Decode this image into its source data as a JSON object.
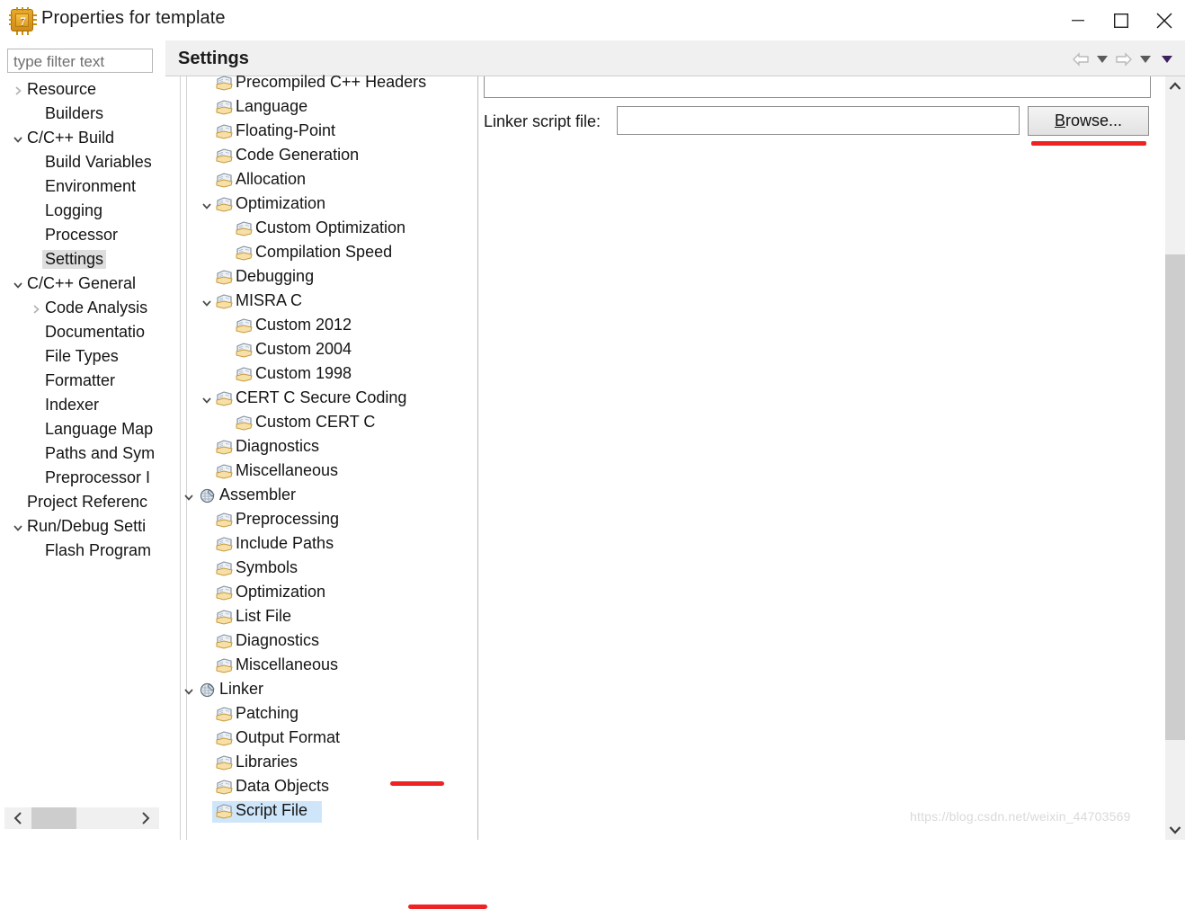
{
  "window": {
    "title": "Properties for template",
    "app_icon": "chip-icon",
    "icon_label": "7",
    "controls": {
      "minimize": "minimize-icon",
      "maximize": "maximize-icon",
      "close": "close-icon"
    }
  },
  "filter": {
    "placeholder": "type filter text",
    "value": ""
  },
  "left_tree": {
    "selected": "Settings",
    "items": [
      {
        "label": "Resource",
        "indent": 0,
        "arrow": "right"
      },
      {
        "label": "Builders",
        "indent": 1,
        "arrow": "none"
      },
      {
        "label": "C/C++ Build",
        "indent": 0,
        "arrow": "down"
      },
      {
        "label": "Build Variables",
        "indent": 1,
        "arrow": "none"
      },
      {
        "label": "Environment",
        "indent": 1,
        "arrow": "none"
      },
      {
        "label": "Logging",
        "indent": 1,
        "arrow": "none"
      },
      {
        "label": "Processor",
        "indent": 1,
        "arrow": "none"
      },
      {
        "label": "Settings",
        "indent": 1,
        "arrow": "none",
        "selected": true
      },
      {
        "label": "C/C++ General",
        "indent": 0,
        "arrow": "down"
      },
      {
        "label": "Code Analysis",
        "indent": 1,
        "arrow": "right"
      },
      {
        "label": "Documentatio",
        "indent": 1,
        "arrow": "none"
      },
      {
        "label": "File Types",
        "indent": 1,
        "arrow": "none"
      },
      {
        "label": "Formatter",
        "indent": 1,
        "arrow": "none"
      },
      {
        "label": "Indexer",
        "indent": 1,
        "arrow": "none"
      },
      {
        "label": "Language Map",
        "indent": 1,
        "arrow": "none"
      },
      {
        "label": "Paths and Sym",
        "indent": 1,
        "arrow": "none"
      },
      {
        "label": "Preprocessor I",
        "indent": 1,
        "arrow": "none"
      },
      {
        "label": "Project Referenc",
        "indent": 0,
        "arrow": "none"
      },
      {
        "label": "Run/Debug Setti",
        "indent": 0,
        "arrow": "down"
      },
      {
        "label": "Flash Program",
        "indent": 1,
        "arrow": "none"
      }
    ],
    "hscroll": {
      "left_arrow": "chevron-left-icon",
      "right_arrow": "chevron-right-icon"
    }
  },
  "page_header": {
    "title": "Settings",
    "nav": [
      {
        "name": "back-icon",
        "glyph": "arrow-left"
      },
      {
        "name": "back-dropdown-icon",
        "glyph": "caret-down"
      },
      {
        "name": "forward-icon",
        "glyph": "arrow-right"
      },
      {
        "name": "forward-dropdown-icon",
        "glyph": "caret-down"
      },
      {
        "name": "menu-dropdown-icon",
        "glyph": "caret-down-dark"
      }
    ]
  },
  "settings_tree": {
    "selected": "Script File",
    "items": [
      {
        "label": "Precompiled C++ Headers",
        "indent": 1,
        "arrow": "none",
        "icon": "page-icon",
        "clipped": true
      },
      {
        "label": "Language",
        "indent": 1,
        "arrow": "none",
        "icon": "page-icon"
      },
      {
        "label": "Floating-Point",
        "indent": 1,
        "arrow": "none",
        "icon": "page-icon"
      },
      {
        "label": "Code Generation",
        "indent": 1,
        "arrow": "none",
        "icon": "page-icon"
      },
      {
        "label": "Allocation",
        "indent": 1,
        "arrow": "none",
        "icon": "page-icon"
      },
      {
        "label": "Optimization",
        "indent": 1,
        "arrow": "down",
        "icon": "page-icon"
      },
      {
        "label": "Custom Optimization",
        "indent": 2,
        "arrow": "none",
        "icon": "page-icon"
      },
      {
        "label": "Compilation Speed",
        "indent": 2,
        "arrow": "none",
        "icon": "page-icon"
      },
      {
        "label": "Debugging",
        "indent": 1,
        "arrow": "none",
        "icon": "page-icon"
      },
      {
        "label": "MISRA C",
        "indent": 1,
        "arrow": "down",
        "icon": "page-icon"
      },
      {
        "label": "Custom 2012",
        "indent": 2,
        "arrow": "none",
        "icon": "page-icon"
      },
      {
        "label": "Custom 2004",
        "indent": 2,
        "arrow": "none",
        "icon": "page-icon"
      },
      {
        "label": "Custom 1998",
        "indent": 2,
        "arrow": "none",
        "icon": "page-icon"
      },
      {
        "label": "CERT C Secure Coding",
        "indent": 1,
        "arrow": "down",
        "icon": "page-icon"
      },
      {
        "label": "Custom CERT C",
        "indent": 2,
        "arrow": "none",
        "icon": "page-icon"
      },
      {
        "label": "Diagnostics",
        "indent": 1,
        "arrow": "none",
        "icon": "page-icon"
      },
      {
        "label": "Miscellaneous",
        "indent": 1,
        "arrow": "none",
        "icon": "page-icon"
      },
      {
        "label": "Assembler",
        "indent": 0,
        "arrow": "down",
        "icon": "tool-icon"
      },
      {
        "label": "Preprocessing",
        "indent": 1,
        "arrow": "none",
        "icon": "page-icon"
      },
      {
        "label": "Include Paths",
        "indent": 1,
        "arrow": "none",
        "icon": "page-icon"
      },
      {
        "label": "Symbols",
        "indent": 1,
        "arrow": "none",
        "icon": "page-icon"
      },
      {
        "label": "Optimization",
        "indent": 1,
        "arrow": "none",
        "icon": "page-icon"
      },
      {
        "label": "List File",
        "indent": 1,
        "arrow": "none",
        "icon": "page-icon"
      },
      {
        "label": "Diagnostics",
        "indent": 1,
        "arrow": "none",
        "icon": "page-icon"
      },
      {
        "label": "Miscellaneous",
        "indent": 1,
        "arrow": "none",
        "icon": "page-icon"
      },
      {
        "label": "Linker",
        "indent": 0,
        "arrow": "down",
        "icon": "tool-icon",
        "annotated": true
      },
      {
        "label": "Patching",
        "indent": 1,
        "arrow": "none",
        "icon": "page-icon"
      },
      {
        "label": "Output Format",
        "indent": 1,
        "arrow": "none",
        "icon": "page-icon"
      },
      {
        "label": "Libraries",
        "indent": 1,
        "arrow": "none",
        "icon": "page-icon"
      },
      {
        "label": "Data Objects",
        "indent": 1,
        "arrow": "none",
        "icon": "page-icon"
      },
      {
        "label": "Script File",
        "indent": 1,
        "arrow": "none",
        "icon": "page-icon",
        "selected": true,
        "annotated": true
      }
    ]
  },
  "script_file_panel": {
    "linker_script_label": "Linker script file:",
    "linker_script_value": "",
    "browse_button": "Browse...",
    "browse_accelerator": "B"
  },
  "watermark": "https://blog.csdn.net/weixin_44703569",
  "colors": {
    "selection_blue": "#cfe6fa",
    "selection_gray": "#dedede",
    "annotation_red": "#ee2424",
    "header_gray": "#f0f0f0",
    "scrollbar_thumb": "#cdcdcd"
  }
}
